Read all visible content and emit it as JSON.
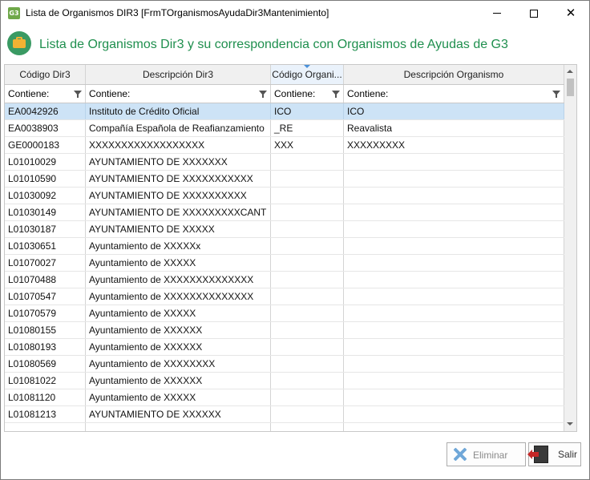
{
  "window": {
    "icon_text": "G3",
    "title": "Lista de Organismos DIR3 [FrmTOrganismosAyudaDir3Mantenimiento]",
    "minimize": "—",
    "maximize": "☐",
    "close": "✕"
  },
  "header": {
    "title": "Lista de Organismos Dir3 y su correspondencia con Organismos de Ayudas de G3"
  },
  "grid": {
    "columns": [
      "Código Dir3",
      "Descripción Dir3",
      "Código Organi...",
      "Descripción Organismo"
    ],
    "filter_placeholder": "Contiene:",
    "filters": [
      "Contiene:",
      "Contiene:",
      "Contiene:",
      "Contiene:"
    ],
    "rows": [
      {
        "codigo": "EA0042926",
        "descripcion": "Instituto de Crédito Oficial",
        "cod_org": "ICO",
        "desc_org": "ICO"
      },
      {
        "codigo": "EA0038903",
        "descripcion": "Compañía Española de Reafianzamiento",
        "cod_org": "_RE",
        "desc_org": "Reavalista"
      },
      {
        "codigo": "GE0000183",
        "descripcion": "XXXXXXXXXXXXXXXXXX",
        "cod_org": "XXX",
        "desc_org": "XXXXXXXXX"
      },
      {
        "codigo": "L01010029",
        "descripcion": "AYUNTAMIENTO DE XXXXXXX",
        "cod_org": "",
        "desc_org": ""
      },
      {
        "codigo": "L01010590",
        "descripcion": "AYUNTAMIENTO DE XXXXXXXXXXX",
        "cod_org": "",
        "desc_org": ""
      },
      {
        "codigo": "L01030092",
        "descripcion": "AYUNTAMIENTO DE XXXXXXXXXX",
        "cod_org": "",
        "desc_org": ""
      },
      {
        "codigo": "L01030149",
        "descripcion": "AYUNTAMIENTO DE XXXXXXXXXCANT",
        "cod_org": "",
        "desc_org": ""
      },
      {
        "codigo": "L01030187",
        "descripcion": "AYUNTAMIENTO DE XXXXX",
        "cod_org": "",
        "desc_org": ""
      },
      {
        "codigo": "L01030651",
        "descripcion": "Ayuntamiento de XXXXXx",
        "cod_org": "",
        "desc_org": ""
      },
      {
        "codigo": "L01070027",
        "descripcion": "Ayuntamiento de XXXXX",
        "cod_org": "",
        "desc_org": ""
      },
      {
        "codigo": "L01070488",
        "descripcion": "Ayuntamiento de XXXXXXXXXXXXXX",
        "cod_org": "",
        "desc_org": ""
      },
      {
        "codigo": "L01070547",
        "descripcion": "Ayuntamiento de XXXXXXXXXXXXXX",
        "cod_org": "",
        "desc_org": ""
      },
      {
        "codigo": "L01070579",
        "descripcion": "Ayuntamiento de XXXXX",
        "cod_org": "",
        "desc_org": ""
      },
      {
        "codigo": "L01080155",
        "descripcion": "Ayuntamiento de XXXXXX",
        "cod_org": "",
        "desc_org": ""
      },
      {
        "codigo": "L01080193",
        "descripcion": "Ayuntamiento de XXXXXX",
        "cod_org": "",
        "desc_org": ""
      },
      {
        "codigo": "L01080569",
        "descripcion": "Ayuntamiento de XXXXXXXX",
        "cod_org": "",
        "desc_org": ""
      },
      {
        "codigo": "L01081022",
        "descripcion": "Ayuntamiento de XXXXXX",
        "cod_org": "",
        "desc_org": ""
      },
      {
        "codigo": "L01081120",
        "descripcion": "Ayuntamiento de XXXXX",
        "cod_org": "",
        "desc_org": ""
      },
      {
        "codigo": "L01081213",
        "descripcion": "AYUNTAMIENTO DE XXXXXX",
        "cod_org": "",
        "desc_org": ""
      },
      {
        "codigo": "",
        "descripcion": "",
        "cod_org": "",
        "desc_org": ""
      }
    ]
  },
  "buttons": {
    "eliminar": "Eliminar",
    "salir": "Salir"
  }
}
